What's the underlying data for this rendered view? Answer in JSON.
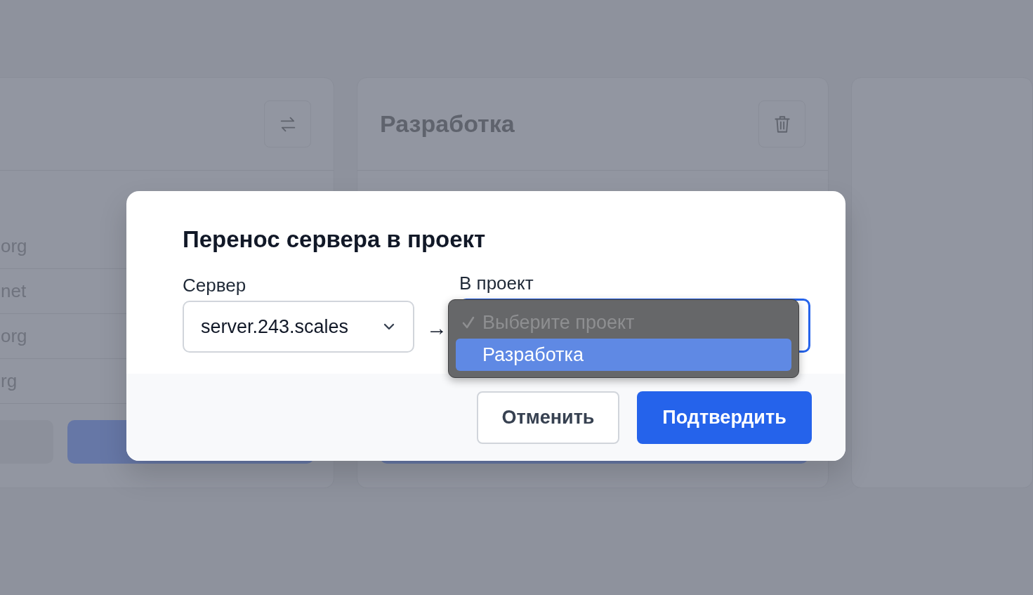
{
  "background": {
    "left_card": {
      "rows": [
        "org",
        "net",
        "org",
        "rg"
      ]
    },
    "middle_card": {
      "title": "Разработка"
    }
  },
  "dialog": {
    "title": "Перенос сервера в проект",
    "server": {
      "label": "Сервер",
      "value": "server.243.scales"
    },
    "arrow": "→",
    "project": {
      "label": "В проект",
      "focused": true,
      "options": [
        {
          "label": "Выберите проект",
          "checked": true,
          "disabled": true,
          "selected": false
        },
        {
          "label": "Разработка",
          "checked": false,
          "disabled": false,
          "selected": true
        }
      ]
    },
    "buttons": [
      {
        "label": "Отменить",
        "kind": "secondary"
      },
      {
        "label": "Подтвердить",
        "kind": "primary"
      }
    ]
  }
}
